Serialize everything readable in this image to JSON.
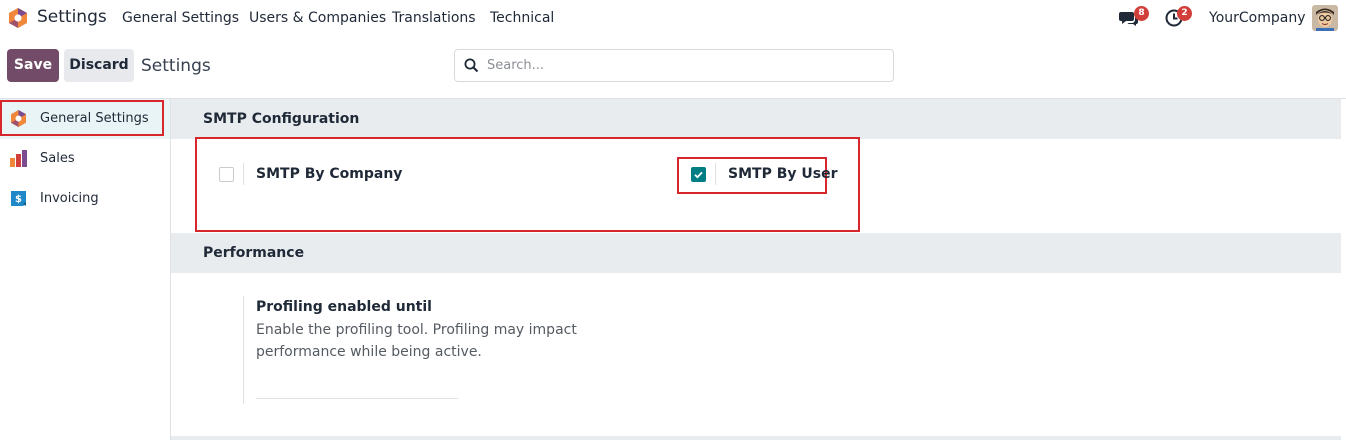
{
  "navbar": {
    "app_title": "Settings",
    "menu": [
      "General Settings",
      "Users & Companies",
      "Translations",
      "Technical"
    ],
    "messages_count": "8",
    "activities_count": "2",
    "company": "YourCompany"
  },
  "control_panel": {
    "save_label": "Save",
    "discard_label": "Discard",
    "breadcrumb": "Settings",
    "search_placeholder": "Search..."
  },
  "sidebar": {
    "items": [
      {
        "label": "General Settings",
        "icon": "odoo-settings-icon",
        "active": true
      },
      {
        "label": "Sales",
        "icon": "sales-icon",
        "active": false
      },
      {
        "label": "Invoicing",
        "icon": "invoicing-icon",
        "active": false
      }
    ]
  },
  "sections": {
    "smtp": {
      "title": "SMTP Configuration",
      "by_company": {
        "label": "SMTP By Company",
        "checked": false
      },
      "by_user": {
        "label": "SMTP By User",
        "checked": true
      }
    },
    "performance": {
      "title": "Performance",
      "profiling_label": "Profiling enabled until",
      "profiling_help": "Enable the profiling tool. Profiling may impact performance while being active."
    }
  },
  "colors": {
    "primary": "#714b67",
    "checkbox_checked": "#017e84",
    "highlight": "#d7262c",
    "badge": "#d23f3a"
  }
}
